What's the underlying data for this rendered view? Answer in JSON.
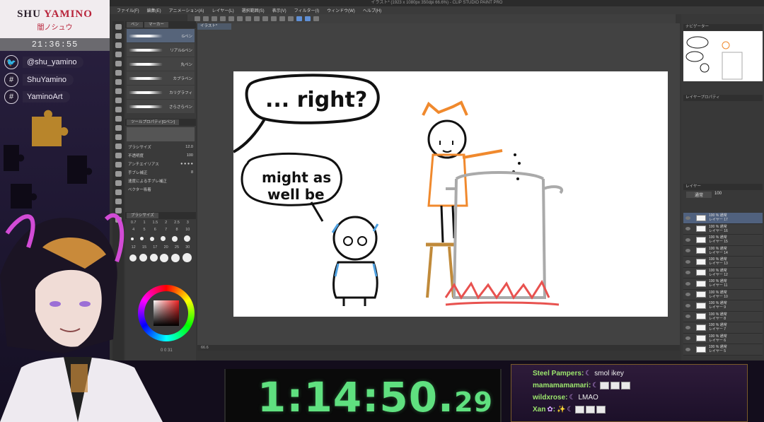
{
  "overlay": {
    "logo_name_a": "SHU ",
    "logo_name_b": "YAMINO",
    "logo_sub": "闇ノシュウ",
    "clock": "21:36:55",
    "socials": [
      {
        "icon": "twitter-icon",
        "handle": "@shu_yamino"
      },
      {
        "icon": "hashtag-icon",
        "handle": "ShuYamino"
      },
      {
        "icon": "hashtag-icon",
        "handle": "YaminoArt"
      }
    ]
  },
  "app": {
    "title": "イラスト* (1923 x 1080px 350dpi 66.6%) - CLIP STUDIO PAINT PRO",
    "menu": [
      "ファイル(F)",
      "編集(E)",
      "アニメーション(A)",
      "レイヤー(L)",
      "選択範囲(S)",
      "表示(V)",
      "フィルター(I)",
      "ウィンドウ(W)",
      "ヘルプ(H)"
    ],
    "doc_tab": "イラスト*",
    "subtool_tabs": [
      "ペン",
      "マーカー"
    ],
    "brushes": [
      "Gペン",
      "リアルGペン",
      "丸ペン",
      "カブラペン",
      "カリグラフィ",
      "さらさらペン"
    ],
    "tool_property_title": "ツールプロパティ[Gペン]",
    "props": [
      {
        "label": "ブラシサイズ",
        "value": "12.0"
      },
      {
        "label": "不透明度",
        "value": "100"
      },
      {
        "label": "アンチエイリアス",
        "value": ""
      },
      {
        "label": "手ブレ補正",
        "value": "8"
      },
      {
        "label": "速度による手ブレ補正",
        "value": ""
      },
      {
        "label": "ベクター吸着",
        "value": ""
      }
    ],
    "brush_size_title": "ブラシサイズ",
    "size_labels_row1": [
      "0.7",
      "1",
      "1.5",
      "2",
      "2.5",
      "3"
    ],
    "size_labels_row2": [
      "4",
      "5",
      "6",
      "7",
      "8",
      "10"
    ],
    "size_labels_row3": [
      "12",
      "15",
      "17",
      "20",
      "25",
      "30"
    ],
    "color_values": "0  0  31",
    "status": "66.6",
    "navigator_title": "ナビゲーター",
    "layer_property_title": "レイヤープロパティ",
    "layer_panel_title": "レイヤー",
    "blend_mode": "通常",
    "opacity": "100",
    "layers": [
      {
        "name": "レイヤー 17",
        "pct": "100 % 通常",
        "selected": true
      },
      {
        "name": "レイヤー 16",
        "pct": "100 % 通常",
        "selected": false
      },
      {
        "name": "レイヤー 15",
        "pct": "100 % 通常",
        "selected": false
      },
      {
        "name": "レイヤー 14",
        "pct": "100 % 通常",
        "selected": false
      },
      {
        "name": "レイヤー 13",
        "pct": "100 % 通常",
        "selected": false
      },
      {
        "name": "レイヤー 12",
        "pct": "100 % 通常",
        "selected": false
      },
      {
        "name": "レイヤー 11",
        "pct": "100 % 通常",
        "selected": false
      },
      {
        "name": "レイヤー 10",
        "pct": "100 % 通常",
        "selected": false
      },
      {
        "name": "レイヤー 9",
        "pct": "100 % 通常",
        "selected": false
      },
      {
        "name": "レイヤー 8",
        "pct": "100 % 通常",
        "selected": false
      },
      {
        "name": "レイヤー 7",
        "pct": "100 % 通常",
        "selected": false
      },
      {
        "name": "レイヤー 6",
        "pct": "100 % 通常",
        "selected": false
      },
      {
        "name": "レイヤー 5",
        "pct": "100 % 通常",
        "selected": false
      }
    ]
  },
  "drawing": {
    "bubble1": "... right?",
    "bubble2_line1": "might as",
    "bubble2_line2": "well be"
  },
  "timer": {
    "main": "1:14:50.",
    "ms": "29"
  },
  "chat": [
    {
      "user": "Steel Pampers",
      "msg": "smol ikey",
      "emotes": 0
    },
    {
      "user": "mamamamamari",
      "msg": "",
      "emotes": 3
    },
    {
      "user": "wildxrose",
      "msg": "LMAO",
      "emotes": 0
    },
    {
      "user": "Xan",
      "msg": "",
      "emotes": 3
    }
  ],
  "colors": {
    "timer": "#5fe07f",
    "chat_user": "#9ce66d",
    "accent": "#b8233a",
    "selection": "#50617e"
  }
}
